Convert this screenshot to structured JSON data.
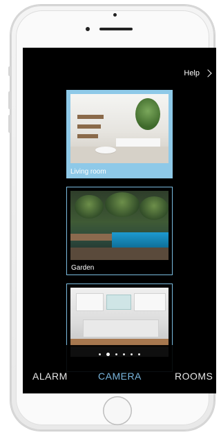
{
  "header": {
    "help_label": "Help"
  },
  "cameras": [
    {
      "label": "Living room",
      "active": true
    },
    {
      "label": "Garden",
      "active": false
    },
    {
      "label": "",
      "active": false
    }
  ],
  "pagination": {
    "count": 6,
    "active_index": 1
  },
  "tabs": [
    {
      "label": "ALARM",
      "active": false
    },
    {
      "label": "CAMERA",
      "active": true
    },
    {
      "label": "ROOMS",
      "active": false
    }
  ],
  "colors": {
    "accent": "#7ab7df",
    "active_card": "#8ec9e8",
    "screen_bg": "#000000"
  }
}
